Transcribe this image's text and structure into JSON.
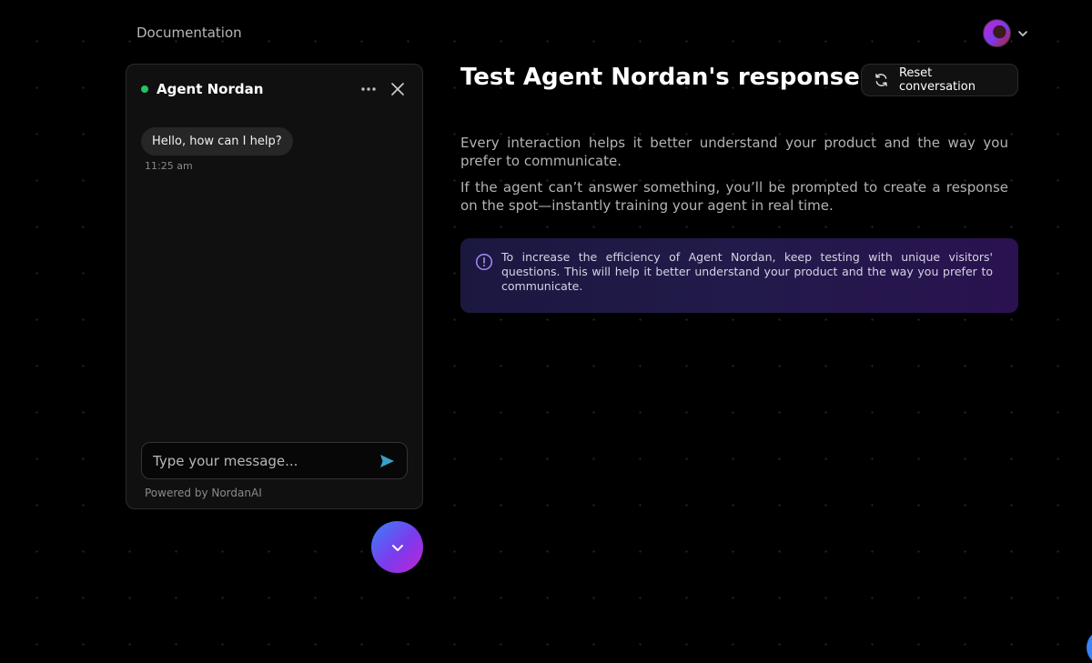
{
  "header": {
    "documentation_link": "Documentation"
  },
  "chat": {
    "agent_name": "Agent Nordan",
    "status_color": "#22c55e",
    "messages": [
      {
        "text": "Hello, how can I help?",
        "time": "11:25 am"
      }
    ],
    "input_placeholder": "Type your message...",
    "powered_by": "Powered by NordanAI"
  },
  "main": {
    "title": "Test Agent Nordan's responses",
    "reset_label": "Reset conversation",
    "paragraph1": "Every interaction helps it better understand your product and the way you prefer to communicate.",
    "paragraph2": "If the agent can’t answer something, you’ll be prompted to create a response on the spot—instantly training your agent in real time.",
    "info_text": "To increase the efficiency of Agent Nordan, keep testing with unique visitors' questions. This will help it better understand your product and the way you prefer to communicate."
  },
  "icons": {
    "more": "more-horizontal-icon",
    "close": "close-icon",
    "send": "send-icon",
    "reset": "refresh-icon",
    "info": "info-icon",
    "chevron": "chevron-down-icon"
  },
  "colors": {
    "accent_gradient_start": "#3b82f6",
    "accent_gradient_end": "#c026d3",
    "info_icon": "#a78bfa"
  }
}
